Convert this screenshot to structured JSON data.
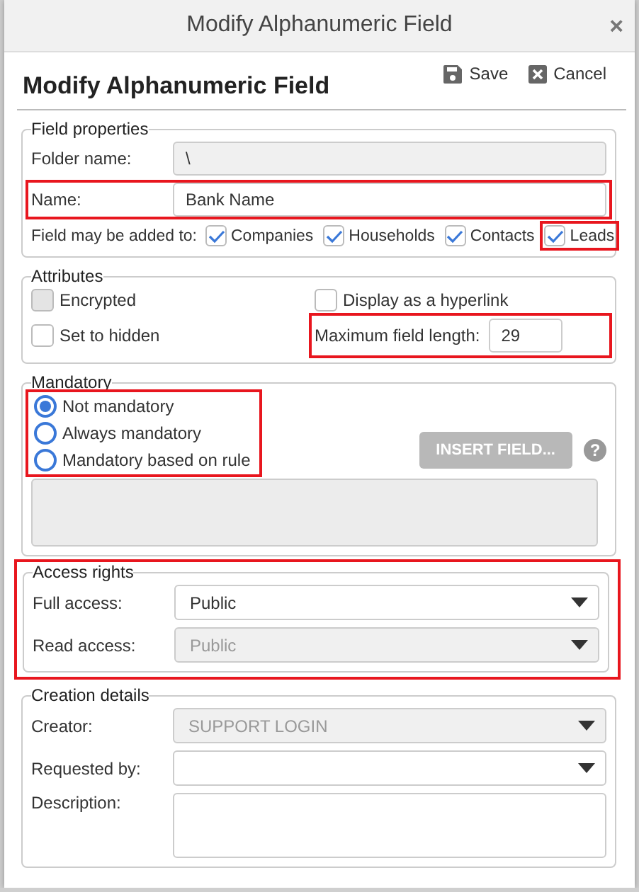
{
  "window": {
    "title": "Modify Alphanumeric Field",
    "close": "×"
  },
  "header": {
    "title": "Modify Alphanumeric Field",
    "actions": [
      {
        "kind": "save",
        "label": "Save"
      },
      {
        "kind": "cancel",
        "label": "Cancel"
      }
    ]
  },
  "field_properties": {
    "legend": "Field properties",
    "folder_name": {
      "label": "Folder name:",
      "value": "\\",
      "disabled": true
    },
    "name": {
      "label": "Name:",
      "value": "Bank Name",
      "highlighted": true
    },
    "added_to": {
      "label": "Field may be added to:",
      "options": [
        {
          "label": "Companies",
          "checked": true,
          "highlighted": false
        },
        {
          "label": "Households",
          "checked": true,
          "highlighted": false
        },
        {
          "label": "Contacts",
          "checked": true,
          "highlighted": false
        },
        {
          "label": "Leads",
          "checked": true,
          "highlighted": true
        }
      ]
    }
  },
  "attributes": {
    "legend": "Attributes",
    "options": [
      {
        "label": "Encrypted",
        "checked": false,
        "disabled": true
      },
      {
        "label": "Display as a hyperlink",
        "checked": false,
        "disabled": false
      },
      {
        "label": "Set to hidden",
        "checked": false,
        "disabled": false
      }
    ],
    "max_length": {
      "label": "Maximum field length:",
      "value": "29",
      "highlighted": true
    }
  },
  "mandatory": {
    "legend": "Mandatory",
    "highlighted": true,
    "options": [
      {
        "label": "Not mandatory",
        "selected": true
      },
      {
        "label": "Always mandatory",
        "selected": false
      },
      {
        "label": "Mandatory based on rule",
        "selected": false
      }
    ],
    "insert_button": {
      "label": "INSERT FIELD...",
      "disabled": true
    },
    "help": "?"
  },
  "access_rights": {
    "legend": "Access rights",
    "highlighted": true,
    "fields": [
      {
        "label": "Full access:",
        "value": "Public",
        "disabled": false
      },
      {
        "label": "Read access:",
        "value": "Public",
        "disabled": true
      }
    ]
  },
  "creation_details": {
    "legend": "Creation details",
    "fields": [
      {
        "label": "Creator:",
        "value": "SUPPORT LOGIN",
        "disabled": true
      },
      {
        "label": "Requested by:",
        "disabled": false
      }
    ],
    "description": {
      "label": "Description:"
    }
  }
}
